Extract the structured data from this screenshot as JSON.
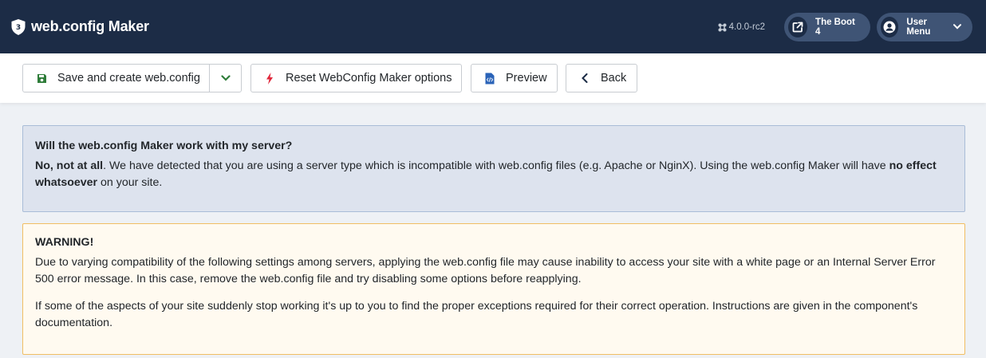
{
  "header": {
    "title": "web.config Maker",
    "logo_icon": "shield-icon",
    "version": "4.0.0-rc2",
    "site_label": "The Boot 4",
    "user_menu_label": "User Menu",
    "colors": {
      "bar": "#1c2c46",
      "pill": "#3f5475"
    }
  },
  "toolbar": {
    "save_label": "Save and create web.config",
    "reset_label": "Reset WebConfig Maker options",
    "preview_label": "Preview",
    "back_label": "Back",
    "icons": {
      "save": "floppy-disk-icon",
      "reset": "bolt-icon",
      "preview": "code-file-icon",
      "back": "chevron-left-icon"
    },
    "colors": {
      "save": "#2f7d3a",
      "reset": "#e0263a",
      "preview": "#2a63b8"
    }
  },
  "info_alert": {
    "title": "Will the web.config Maker work with my server?",
    "lead_bold": "No, not at all",
    "text_1": ". We have detected that you are using a server type which is incompatible with web.config files (e.g. Apache or NginX). Using the web.config Maker will have ",
    "bold_2": "no effect whatsoever",
    "text_2": " on your site."
  },
  "warning_alert": {
    "title": "WARNING!",
    "paragraph_1": "Due to varying compatibility of the following settings among servers, applying the web.config file may cause inability to access your site with a white page or an Internal Server Error 500 error message. In this case, remove the web.config file and try disabling some options before reapplying.",
    "paragraph_2": "If some of the aspects of your site suddenly stop working it's up to you to find the proper exceptions required for their correct operation. Instructions are given in the component's documentation."
  }
}
